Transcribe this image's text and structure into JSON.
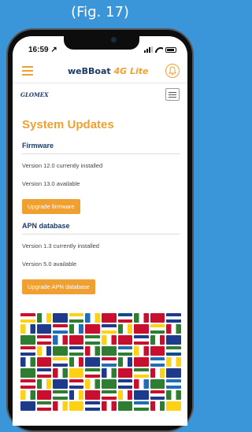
{
  "caption": "(Fig. 17)",
  "status_bar": {
    "time": "16:59 ↗"
  },
  "app_bar": {
    "brand_main": "weBBoat",
    "brand_suffix": "4G Lite"
  },
  "logo": {
    "text": "GLOMEX"
  },
  "main": {
    "title": "System Updates",
    "firmware": {
      "heading": "Firmware",
      "installed": "Version 12.0 currently installed",
      "available": "Version 13.0 available",
      "button": "Upgrade firmware"
    },
    "apn": {
      "heading": "APN database",
      "installed": "Version 1.3 currently installed",
      "available": "Version 5.0 available",
      "button": "Upgrade APN database"
    }
  },
  "colors": {
    "accent": "#f0a030",
    "brand_blue": "#1a3a6b",
    "background": "#3b96d9"
  },
  "flag_colors": [
    "#c8102e",
    "#2e7d32",
    "#1e3a8a",
    "#fcd116",
    "#1e6fb8",
    "#c8102e",
    "#0a4d8c",
    "#2e7d32",
    "#c8102e",
    "#1e3a8a",
    "#fcd116",
    "#1e3a8a",
    "#c8102e",
    "#2e7d32",
    "#c8102e",
    "#1e3a8a",
    "#2e7d32",
    "#c8102e",
    "#fcd116",
    "#c8102e",
    "#2e7d32",
    "#c8102e",
    "#1e6fb8",
    "#c8102e",
    "#2e7d32",
    "#fcd116",
    "#c8102e",
    "#1e3a8a",
    "#2e7d32",
    "#1e3a8a",
    "#c8102e",
    "#fcd116",
    "#2e7d32",
    "#1e3a8a",
    "#c8102e",
    "#2e7d32",
    "#1e6fb8",
    "#fcd116",
    "#c8102e",
    "#2e7d32",
    "#1e3a8a",
    "#c8102e",
    "#fcd116",
    "#2e7d32",
    "#1e3a8a",
    "#c8102e",
    "#2e7d32",
    "#c8102e",
    "#1e6fb8",
    "#fcd116",
    "#2e7d32",
    "#1e3a8a",
    "#c8102e",
    "#fcd116",
    "#2e7d32",
    "#1e3a8a",
    "#c8102e",
    "#2e7d32",
    "#c8102e",
    "#1e3a8a",
    "#c8102e",
    "#2e7d32",
    "#1e3a8a",
    "#c8102e",
    "#fcd116",
    "#2e7d32",
    "#1e3a8a",
    "#c8102e",
    "#2e7d32",
    "#1e6fb8",
    "#fcd116",
    "#c8102e",
    "#2e7d32",
    "#1e3a8a",
    "#c8102e",
    "#2e7d32",
    "#fcd116",
    "#1e3a8a",
    "#c8102e",
    "#2e7d32",
    "#1e3a8a",
    "#2e7d32",
    "#c8102e",
    "#fcd116",
    "#1e3a8a",
    "#c8102e",
    "#2e7d32",
    "#1e6fb8",
    "#c8102e",
    "#fcd116"
  ]
}
